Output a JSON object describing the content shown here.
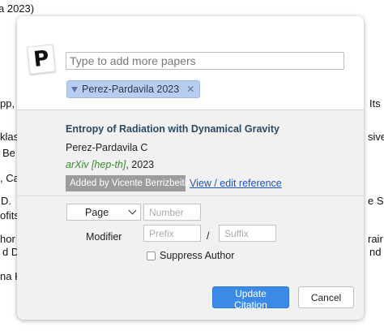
{
  "background": {
    "fragments": [
      "a 2023)",
      "pp,",
      "klas",
      "Be",
      ", Ca",
      "D.",
      "ofits",
      "hor",
      "d D",
      "na K",
      "Its",
      "sive",
      "e S",
      "rair",
      "nd"
    ]
  },
  "dialog": {
    "logo_letter": "P",
    "search": {
      "placeholder": "Type to add more papers",
      "value": ""
    },
    "tag": {
      "label": "Perez-Pardavila 2023",
      "remove_symbol": "✕"
    },
    "item": {
      "title": "Entropy of Radiation with Dynamical Gravity",
      "authors": "Perez-Pardavila C",
      "journal": "arXiv [hep-th]",
      "year_text": ", 2023",
      "added_by": "Added by Vicente Berrizbeitia",
      "view_link": "View / edit reference"
    },
    "locator": {
      "selected": "Page",
      "number_placeholder": "Number",
      "modifier_label": "Modifier",
      "prefix_placeholder": "Prefix",
      "slash": "/",
      "suffix_placeholder": "Suffix",
      "suppress_label": "Suppress Author"
    },
    "buttons": {
      "update": "Update Citation",
      "cancel": "Cancel"
    }
  },
  "colors": {
    "primary_button": "#3b8ae8",
    "tag_bg": "#b9cdf0",
    "title": "#2b4a66",
    "journal": "#3a8a2f",
    "link": "#1a55c4"
  }
}
